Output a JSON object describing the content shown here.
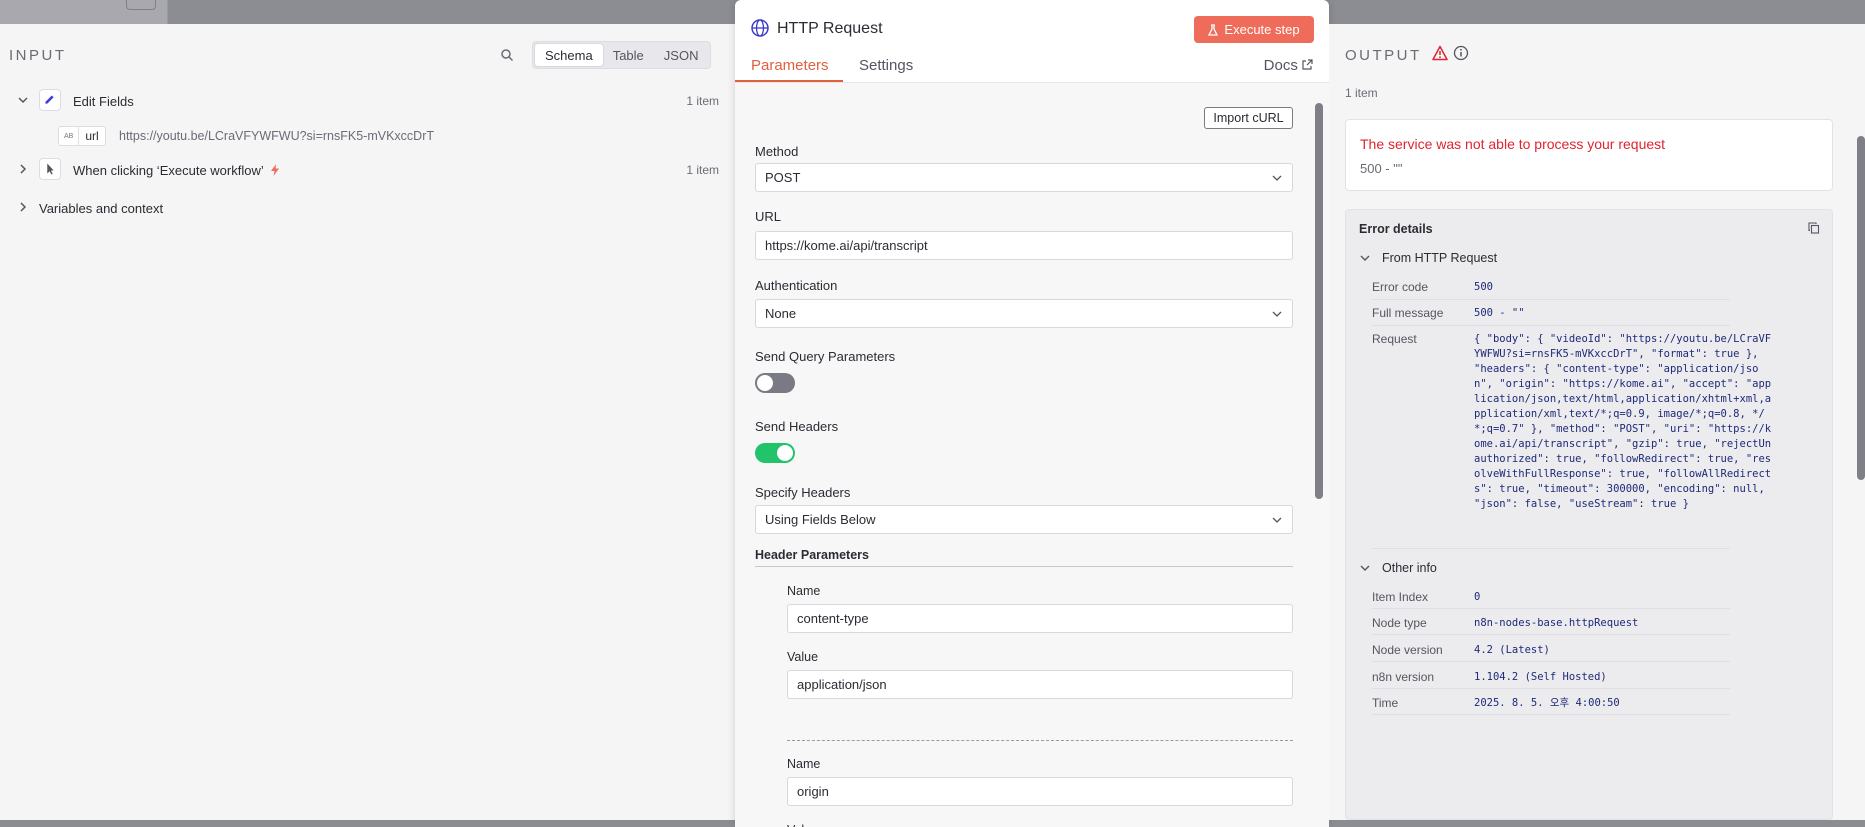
{
  "input": {
    "title": "INPUT",
    "view_tabs": [
      "Schema",
      "Table",
      "JSON"
    ],
    "active_view": "Schema",
    "edit_fields": {
      "label": "Edit Fields",
      "count": "1 item"
    },
    "url_field": {
      "type": "AB",
      "key": "url",
      "value": "https://youtu.be/LCraVFYWFWU?si=rnsFK5-mVKxccDrT"
    },
    "trigger": {
      "label": "When clicking ‘Execute workflow’",
      "count": "1 item"
    },
    "variables": {
      "label": "Variables and context"
    }
  },
  "node": {
    "title": "HTTP Request",
    "execute_label": "Execute step",
    "tabs": [
      "Parameters",
      "Settings"
    ],
    "active_tab": "Parameters",
    "docs_label": "Docs",
    "import_curl_label": "Import cURL",
    "method": {
      "label": "Method",
      "value": "POST"
    },
    "url": {
      "label": "URL",
      "value": "https://kome.ai/api/transcript"
    },
    "authentication": {
      "label": "Authentication",
      "value": "None"
    },
    "send_query": {
      "label": "Send Query Parameters",
      "enabled": false
    },
    "send_headers": {
      "label": "Send Headers",
      "enabled": true
    },
    "specify_headers": {
      "label": "Specify Headers",
      "value": "Using Fields Below"
    },
    "header_params": {
      "label": "Header Parameters",
      "name_label": "Name",
      "value_label": "Value",
      "items": [
        {
          "name": "content-type",
          "value": "application/json"
        },
        {
          "name": "origin"
        }
      ]
    }
  },
  "output": {
    "title": "OUTPUT",
    "count": "1 item",
    "error_title": "The service was not able to process your request",
    "error_sub": "500 - \"\"",
    "details_title": "Error details",
    "from_group": "From HTTP Request",
    "error_code": {
      "key": "Error code",
      "value": "500"
    },
    "full_message": {
      "key": "Full message",
      "value": "500 - \"\""
    },
    "request": {
      "key": "Request",
      "value": "{ \"body\": { \"videoId\": \"https://youtu.be/LCraVFYWFWU?si=rnsFK5-mVKxccDrT\", \"format\": true }, \"headers\": { \"content-type\": \"application/json\", \"origin\": \"https://kome.ai\", \"accept\": \"application/json,text/html,application/xhtml+xml,application/xml,text/*;q=0.9, image/*;q=0.8, */*;q=0.7\" }, \"method\": \"POST\", \"uri\": \"https://kome.ai/api/transcript\", \"gzip\": true, \"rejectUnauthorized\": true, \"followRedirect\": true, \"resolveWithFullResponse\": true, \"followAllRedirects\": true, \"timeout\": 300000, \"encoding\": null, \"json\": false, \"useStream\": true }"
    },
    "other_group": "Other info",
    "item_index": {
      "key": "Item Index",
      "value": "0"
    },
    "node_type": {
      "key": "Node type",
      "value": "n8n-nodes-base.httpRequest"
    },
    "node_version": {
      "key": "Node version",
      "value": "4.2 (Latest)"
    },
    "n8n_version": {
      "key": "n8n version",
      "value": "1.104.2 (Self Hosted)"
    },
    "time": {
      "key": "Time",
      "value": "2025. 8. 5. 오후 4:00:50"
    }
  },
  "colors": {
    "accent": "#e2603f",
    "execute": "#ef6c5a",
    "error": "#e0242f",
    "toggle_on": "#22c36a"
  }
}
